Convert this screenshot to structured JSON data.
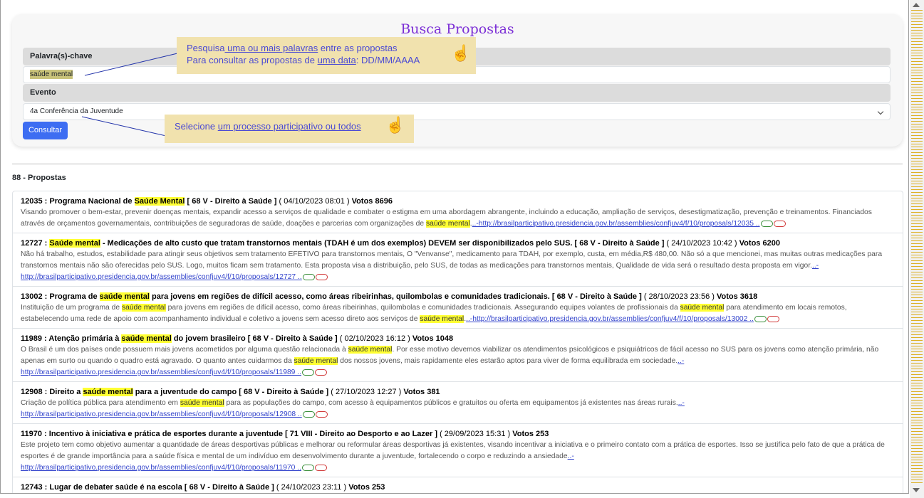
{
  "search": {
    "title": "Busca Propostas",
    "keyword_label": "Palavra(s)-chave",
    "keyword_value": "saúde mental",
    "event_label": "Evento",
    "event_value": "4a Conferência da Juventude",
    "button": "Consultar"
  },
  "tips": {
    "keyword_line1_a": "Pesquisa",
    "keyword_line1_b": " uma ou mais palavras",
    "keyword_line1_c": " entre as propostas",
    "keyword_line2_a": "Para consultar as propostas de ",
    "keyword_line2_b": "uma data",
    "keyword_line2_c": ": DD/MM/AAAA",
    "event_a": "Selecione ",
    "event_b": "um processo participativo ou todos",
    "hand_icon": "pointer-hand-icon"
  },
  "results": {
    "count": "88 - Propostas",
    "items": [
      {
        "h1": "12035 : Programa Nacional de ",
        "h_hl": "Saúde Mental",
        "h2": " [ 68 V - Direito à Saúde ]",
        "date": " ( 04/10/2023 08:01 )",
        "votes": " Votos 8696",
        "b1": "Visando promover o bem-estar, prevenir doenças mentais, expandir acesso a serviços de qualidade e combater o estigma em uma abordagem abrangente, incluindo a educação, ampliação de serviços, desestigmatização, prevenção e treinamentos. Financiados através de orçamentos governamentais, contribuições de seguradoras de saúde, doações e parcerias com organizações de ",
        "b_hl": "saúde mental",
        "b2": ".",
        "link": "..-http://brasilparticipativo.presidencia.gov.br/assemblies/confjuv4/f/10/proposals/12035 .."
      },
      {
        "h_hl": "Saúde mental",
        "h2": " - Medicações de alto custo que tratam transtornos mentais (TDAH é um dos exemplos) DEVEM ser disponibilizados pelo SUS. [ 68 V - Direito à Saúde ]",
        "h1": "12727 : ",
        "date": " ( 24/10/2023 10:42 )",
        "votes": " Votos 6200",
        "b1": "Não há trabalho, estudos, estabilidade para atingir seus objetivos sem tratamento EFETIVO para transtornos mentais, O \"Venvanse\", medicamento para TDAH, por exemplo, custa, em média,R$ 480,00. Não só a que mencionei, mas muitas outras medicações para transtornos mentais não são oferecidas pelo SUS. Logo, muitos ficam sem tratamento. Esta proposta visa a distribuição, pelo SUS, de todas as medicações para transtornos mentais, Qualidade de vida será o resultado desta proposta em vigor.",
        "link_a": "..-",
        "link": "http://brasilparticipativo.presidencia.gov.br/assemblies/confjuv4/f/10/proposals/12727 .."
      },
      {
        "h1": "13002 : Programa de ",
        "h_hl": "saúde mental",
        "h2": " para jovens em regiões de difícil acesso, como áreas ribeirinhas, quilombolas e comunidades tradicionais. [ 68 V - Direito à Saúde ]",
        "date": " ( 28/10/2023 23:56 )",
        "votes": " Votos 3618",
        "b1": "Instituição de um programa de ",
        "b_hl": "saúde mental",
        "b2": " para jovens em regiões de difícil acesso, como áreas ribeirinhas, quilombolas e comunidades tradicionais. Assegurando equipes volantes de profissionais da ",
        "b_hl2": "saúde mental",
        "b3": " para atendimento em locais remotos, estabelecendo uma rede de apoio com acompanhamento individual e coletivo a jovens sem acesso direto aos serviços de ",
        "b_hl3": "saúde mental",
        "b4": ".",
        "link": "..-http://brasilparticipativo.presidencia.gov.br/assemblies/confjuv4/f/10/proposals/13002 .."
      },
      {
        "h1": "11989 : Atenção primária à ",
        "h_hl": "saúde mental",
        "h2": " do jovem brasileiro [ 68 V - Direito à Saúde ]",
        "date": " ( 02/10/2023 16:12 )",
        "votes": " Votos 1048",
        "b1": "O Brasil é um dos países onde possuem mais jovens acometidos por alguma questão relacionada à ",
        "b_hl": "saúde mental",
        "b2": ". Por esse motivo devemos viabilizar os atendimentos psicológicos e psiquiátricos de fácil acesso no SUS para os jovens como atenção primária, não apenas em surto ou quando o quadro está agravado. O quanto antes cuidarmos da ",
        "b_hl2": "saúde mental",
        "b3": " dos nossos jovens, mais rapidamente eles estarão aptos para viver de forma equilibrada em sociedade.",
        "link_a": "..-",
        "link": "http://brasilparticipativo.presidencia.gov.br/assemblies/confjuv4/f/10/proposals/11989 .."
      },
      {
        "h1": "12908 : Direito a ",
        "h_hl": "saúde mental",
        "h2": " para a juventude do campo [ 68 V - Direito à Saúde ]",
        "date": " ( 27/10/2023 12:27 )",
        "votes": " Votos 381",
        "b1": "Criação de política pública para atendimento em ",
        "b_hl": "saúde mental",
        "b2": " para as populações do campo, com acesso à equipamentos públicos e gratuitos ou oferta em equipamentos já existentes nas áreas rurais.",
        "link_a": "..-",
        "link": "http://brasilparticipativo.presidencia.gov.br/assemblies/confjuv4/f/10/proposals/12908 .."
      },
      {
        "h1": "11970 : Incentivo à iniciativa e prática de esportes durante a juventude [ 71 VIII - Direito ao Desporto e ao Lazer ]",
        "date": " ( 29/09/2023 15:31 )",
        "votes": " Votos 253",
        "b1": "Este projeto tem como objetivo aumentar a quantidade de áreas desportivas públicas e melhorar ou reformular áreas desportivas já existentes, visando incentivar a iniciativa e o primeiro contato com a prática de esportes. Isso se justifica pelo fato de que a prática de esportes é de grande importância para a saúde física e mental de um indivíduo em desenvolvimento durante a juventude, fortalecendo o corpo e reduzindo a ansiedade",
        "link_a": "..-",
        "link": "http://brasilparticipativo.presidencia.gov.br/assemblies/confjuv4/f/10/proposals/11970 .."
      },
      {
        "h1": "12743 : Lugar de debater saúde é na escola [ 68 V - Direito à Saúde ]",
        "date": " ( 24/10/2023 23:11 )",
        "votes": " Votos 253"
      }
    ]
  }
}
